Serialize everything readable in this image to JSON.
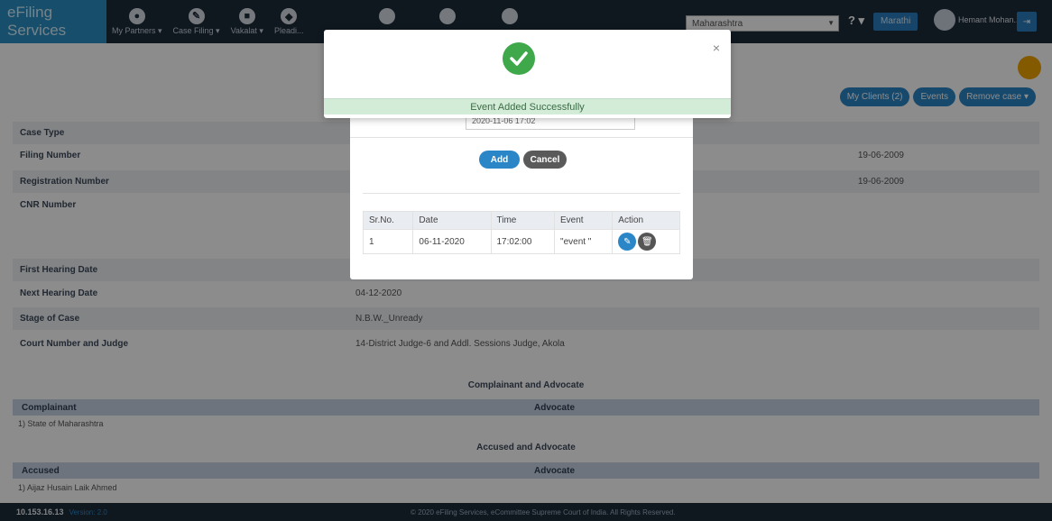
{
  "navbar": {
    "brand": "eFiling Services",
    "items": [
      {
        "label": "My Partners ▾",
        "icon": "user-icon"
      },
      {
        "label": "Case Filing ▾",
        "icon": "file-icon"
      },
      {
        "label": "Vakalat ▾",
        "icon": "doc-icon"
      },
      {
        "label": "Pleadi...",
        "icon": "pleading-icon"
      }
    ],
    "select_value": "Maharashtra",
    "help": "? ▾",
    "lang": "Marathi",
    "user": "Hemant Mohan...",
    "logout_icon": "logout-icon"
  },
  "toolbar": {
    "pills": [
      "My Clients (2)",
      "Events",
      "Remove case ▾"
    ]
  },
  "case": {
    "rows": [
      {
        "label": "Case Type",
        "value": "",
        "right": ""
      },
      {
        "label": "Filing Number",
        "value": "",
        "right": "19-06-2009"
      },
      {
        "label": "Registration Number",
        "value": "",
        "right": "19-06-2009"
      },
      {
        "label": "CNR Number",
        "value": "",
        "right": ""
      },
      {
        "label": "First Hearing Date",
        "value": "",
        "right": ""
      },
      {
        "label": "Next Hearing Date",
        "value": "04-12-2020",
        "right": ""
      },
      {
        "label": "Stage of Case",
        "value": "N.B.W._Unready",
        "right": ""
      },
      {
        "label": "Court Number and Judge",
        "value": "14-District Judge-6 and Addl. Sessions Judge, Akola",
        "right": ""
      }
    ]
  },
  "complainant": {
    "title": "Complainant and Advocate",
    "col1": "Complainant",
    "col2": "Advocate",
    "row": "1) State of Maharashtra"
  },
  "accused": {
    "title": "Accused and Advocate",
    "col1": "Accused",
    "col2": "Advocate",
    "row": "1) Aijaz Husain Laik Ahmed"
  },
  "footer": {
    "ip": "10.153.16.13",
    "version": "Version: 2.0",
    "copyright": "© 2020 eFiling Services, eCommittee Supreme Court of India. All Rights Reserved."
  },
  "event_modal": {
    "datetime_value": "2020-11-06 17:02",
    "add_label": "Add",
    "cancel_label": "Cancel",
    "table": {
      "headers": [
        "Sr.No.",
        "Date",
        "Time",
        "Event",
        "Action"
      ],
      "rows": [
        {
          "sr": "1",
          "date": "06-11-2020",
          "time": "17:02:00",
          "event": "\"event \""
        }
      ]
    }
  },
  "success_modal": {
    "message": "Event Added Successfully",
    "close": "×"
  },
  "colors": {
    "navbar": "#1d2a3a",
    "brand": "#2a8fc4",
    "accent": "#2a86c7",
    "success": "#3fa84a",
    "success_bar": "#d3ecd8"
  }
}
